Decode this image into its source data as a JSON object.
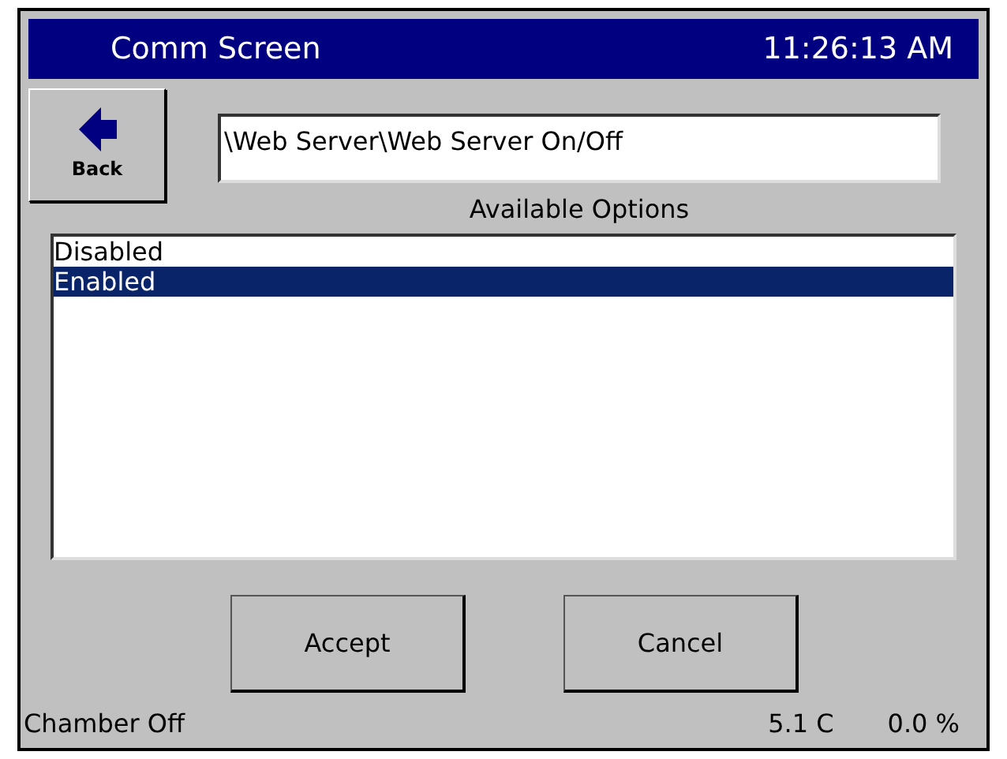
{
  "title_bar": {
    "title": "Comm Screen",
    "time": "11:26:13 AM"
  },
  "back_button": {
    "label": "Back"
  },
  "path_field": {
    "value": "\\Web Server\\Web Server On/Off"
  },
  "options_label": "Available Options",
  "options": [
    {
      "label": "Disabled",
      "selected": false
    },
    {
      "label": "Enabled",
      "selected": true
    }
  ],
  "buttons": [
    "Accept",
    "Cancel"
  ],
  "status_bar": {
    "state": "Chamber Off",
    "temperature": "5.1 C",
    "humidity": "0.0 %"
  }
}
